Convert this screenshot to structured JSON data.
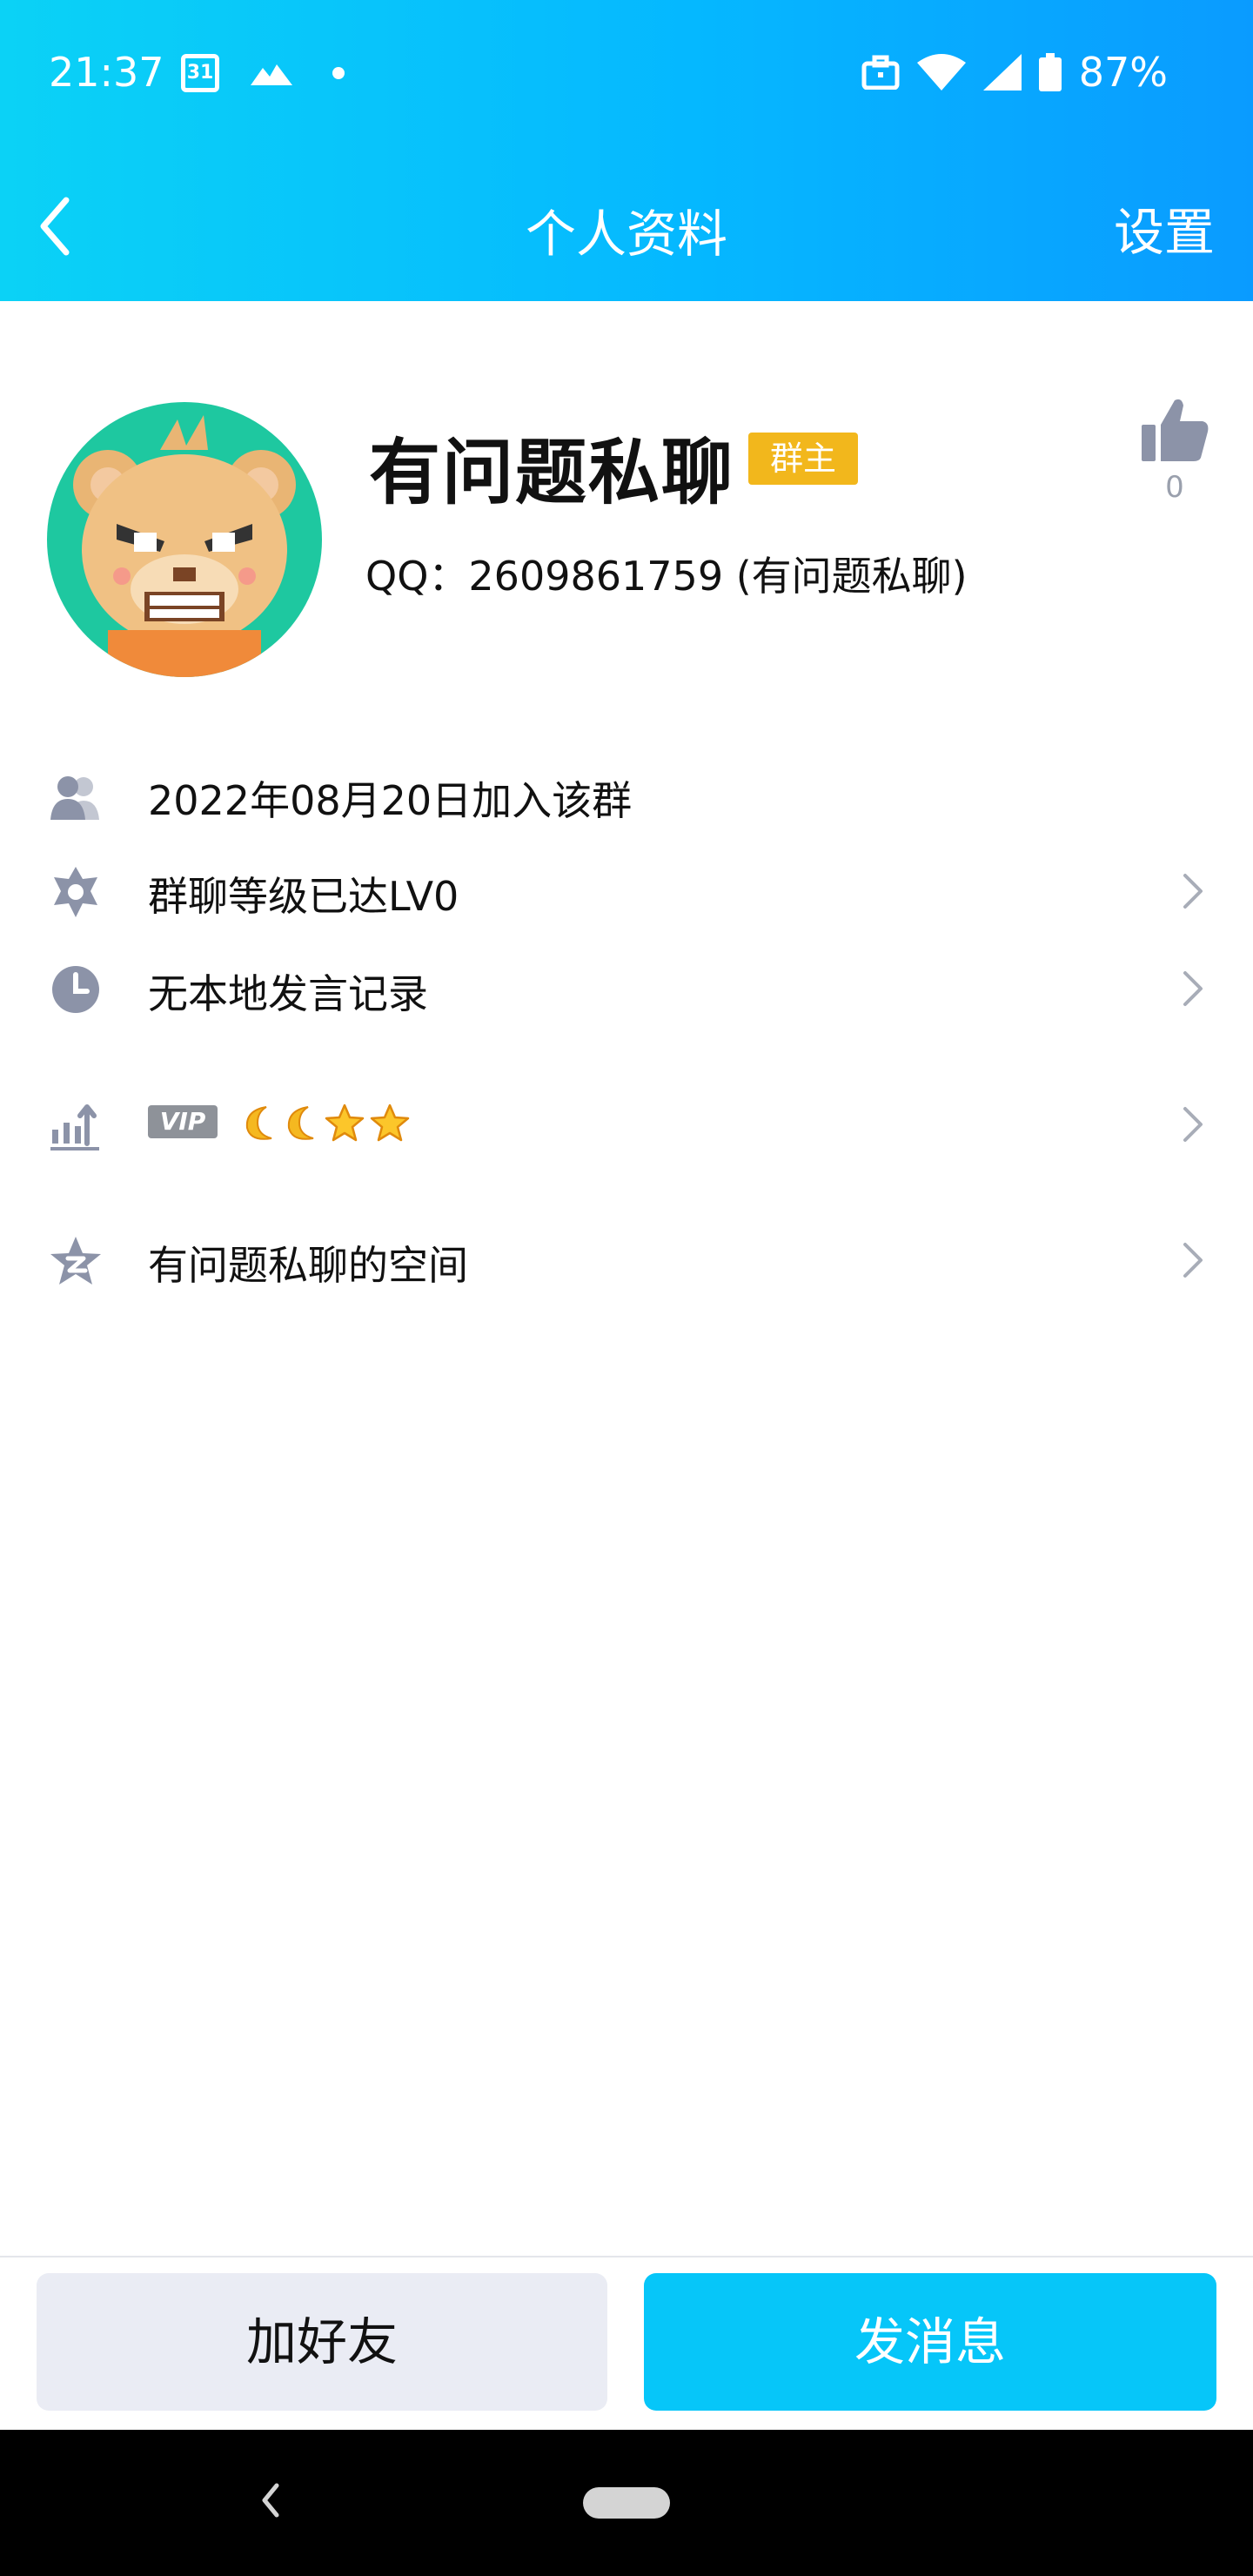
{
  "status_bar": {
    "time": "21:37",
    "calendar_day": "31",
    "battery": "87%"
  },
  "header": {
    "title": "个人资料",
    "settings_label": "设置"
  },
  "profile": {
    "name": "有问题私聊",
    "role_badge": "群主",
    "likes": "0",
    "qq_line": "QQ：2609861759 (有问题私聊)"
  },
  "info_rows": {
    "joined": "2022年08月20日加入该群",
    "level": "群聊等级已达LV0",
    "history": "无本地发言记录",
    "vip_label": "VIP",
    "space": "有问题私聊的空间"
  },
  "buttons": {
    "add_friend": "加好友",
    "send_message": "发消息"
  },
  "colors": {
    "header_start": "#0bd2f6",
    "header_end": "#0a9bff",
    "badge": "#f2b71c",
    "primary_button": "#06c6f9",
    "secondary_button": "#eaecf4"
  }
}
